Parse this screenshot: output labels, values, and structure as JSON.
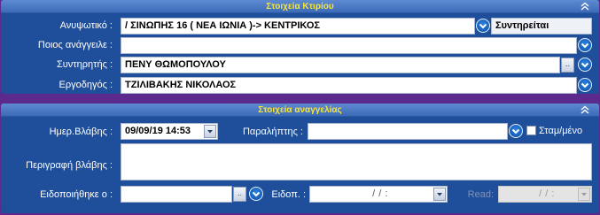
{
  "building_panel": {
    "title": "Στοιχεία Κτιρίου",
    "lift_label": "Ανυψωτικό :",
    "lift_value": "/ ΣΙΝΩΠΗΣ 16 ( ΝΕΑ ΙΩΝΙΑ )-> ΚΕΝΤΡΙΚΟΣ",
    "lift_status": "Συντηρείται",
    "reporter_label": "Ποιος ανάγγειλε :",
    "reporter_value": "",
    "maintainer_label": "Συντηρητής :",
    "maintainer_value": "ΠΕΝΥ ΘΩΜΟΠΟΥΛΟΥ",
    "contractor_label": "Εργοδηγός :",
    "contractor_value": "ΤΖΙΛΙΒΑΚΗΣ ΝΙΚΟΛΑΟΣ",
    "collapse_icon": "double-chevron-up-icon"
  },
  "report_panel": {
    "title": "Στοιχεία αναγγελίας",
    "fault_date_label": "Ημερ.Βλάβης :",
    "fault_date_value": "09/09/19 14:53",
    "receiver_label": "Παραλήπτης :",
    "receiver_value": "",
    "sms_label": "Σταμ/μένο",
    "sms_checked": false,
    "description_label": "Περιγραφή βλάβης :",
    "description_value": "",
    "notified_label": "Ειδοποιήθηκε ο :",
    "notified_value": "",
    "notify_date_label": "Ειδοπ. :",
    "notify_date_value": "/ /  :",
    "read_label": "Read:",
    "read_value": "/ /  :",
    "collapse_icon": "double-chevron-up-icon"
  },
  "ellipsis_label": "..",
  "colors": {
    "background": "#5b2a8c",
    "panel": "#1f4f9a",
    "title_text": "#f6e63a",
    "drop_button": "#0d4ea8"
  }
}
